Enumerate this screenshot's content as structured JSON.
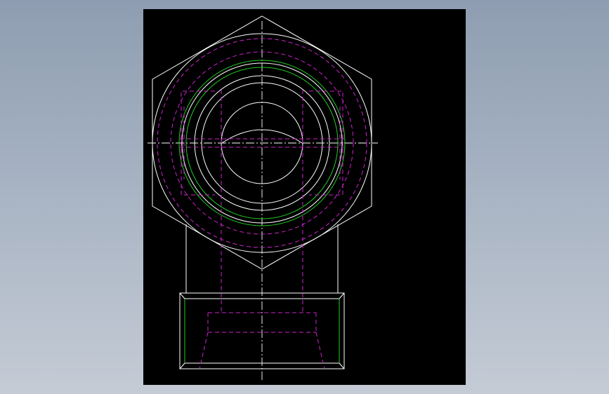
{
  "drawing": {
    "view": "cad-drawing-viewport",
    "colors": {
      "background": "#000000",
      "outline": "#ffffff",
      "hidden_line": "#cc22cc",
      "thread_line": "#22cc22",
      "centerline": "#ffffff",
      "app_background": "#a3afc0"
    },
    "line_types": [
      "visible",
      "hidden",
      "thread",
      "center"
    ]
  }
}
